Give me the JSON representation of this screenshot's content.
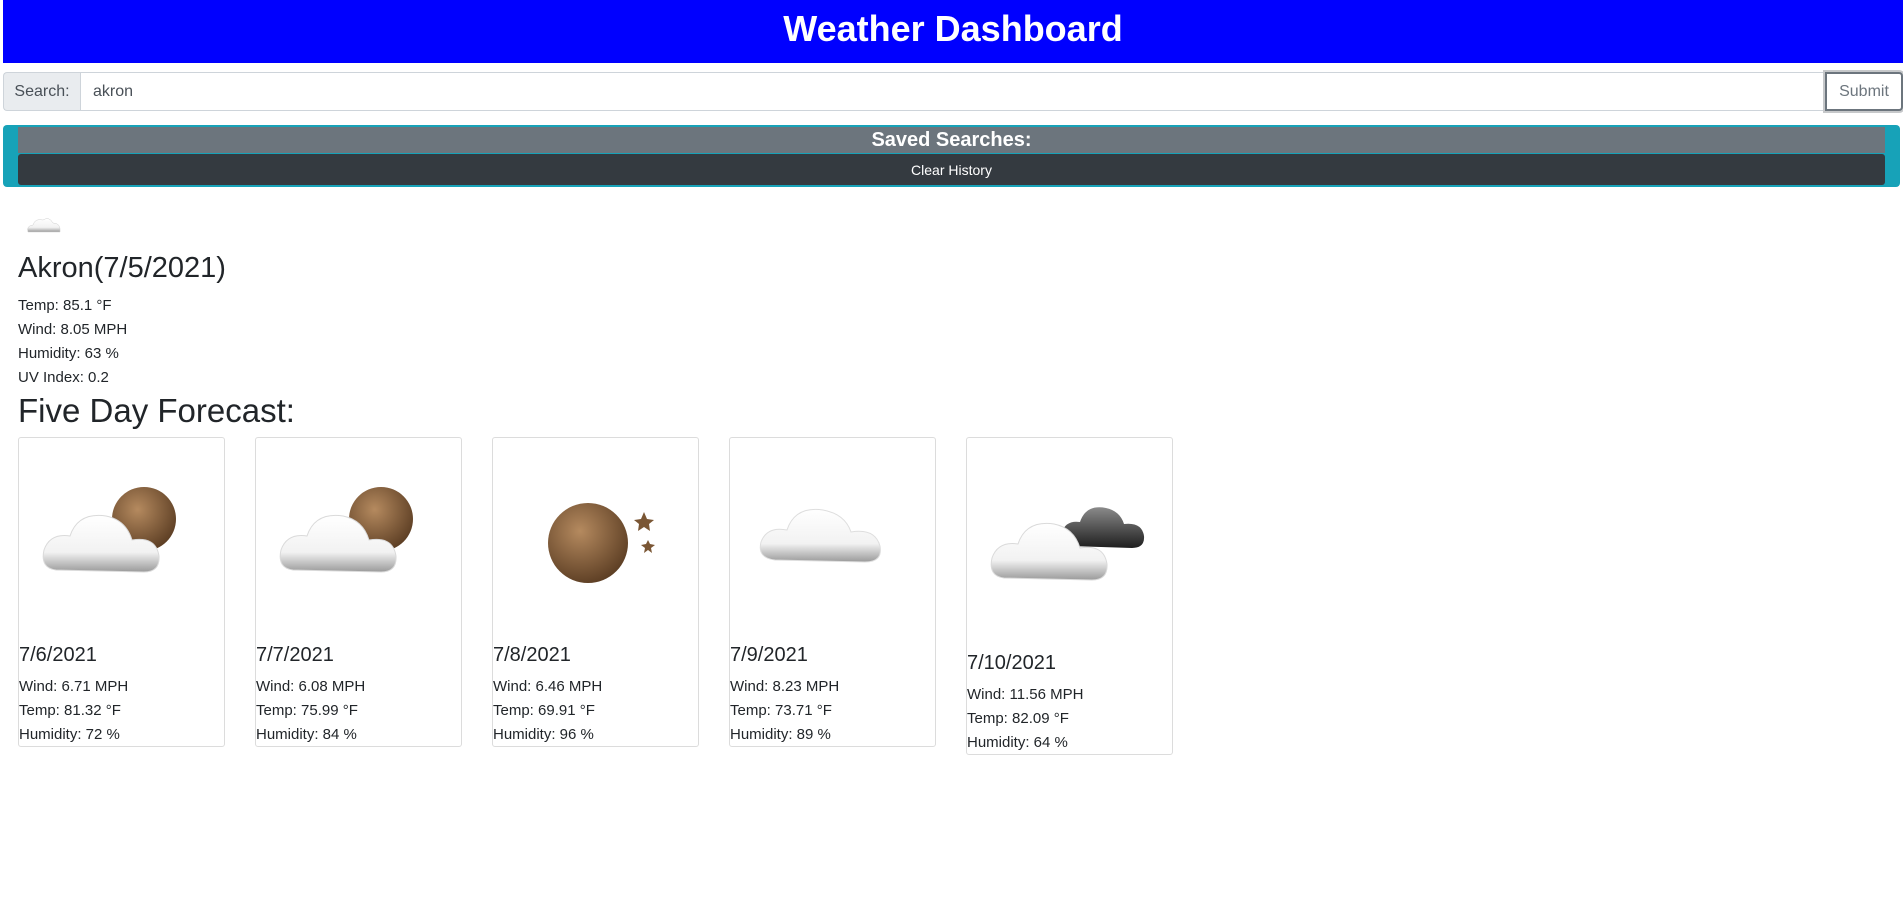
{
  "header": {
    "title": "Weather Dashboard"
  },
  "search": {
    "label": "Search:",
    "value": "akron",
    "submit_label": "Submit"
  },
  "saved_searches": {
    "title": "Saved Searches:",
    "clear_label": "Clear History"
  },
  "current": {
    "icon": "cloud-icon",
    "title": "Akron(7/5/2021)",
    "temp": "Temp: 85.1 °F",
    "wind": "Wind: 8.05 MPH",
    "humidity": "Humidity: 63 %",
    "uv": "UV Index: 0.2"
  },
  "forecast": {
    "title": "Five Day Forecast:",
    "days": [
      {
        "icon": "partly-cloudy-night-icon",
        "date": "7/6/2021",
        "wind": "Wind: 6.71 MPH",
        "temp": "Temp: 81.32 °F",
        "humidity": "Humidity: 72 %"
      },
      {
        "icon": "partly-cloudy-night-icon",
        "date": "7/7/2021",
        "wind": "Wind: 6.08 MPH",
        "temp": "Temp: 75.99 °F",
        "humidity": "Humidity: 84 %"
      },
      {
        "icon": "clear-night-icon",
        "date": "7/8/2021",
        "wind": "Wind: 6.46 MPH",
        "temp": "Temp: 69.91 °F",
        "humidity": "Humidity: 96 %"
      },
      {
        "icon": "cloud-icon",
        "date": "7/9/2021",
        "wind": "Wind: 8.23 MPH",
        "temp": "Temp: 73.71 °F",
        "humidity": "Humidity: 89 %"
      },
      {
        "icon": "broken-clouds-icon",
        "date": "7/10/2021",
        "wind": "Wind: 11.56 MPH",
        "temp": "Temp: 82.09 °F",
        "humidity": "Humidity: 64 %"
      }
    ]
  },
  "colors": {
    "header_bg": "#0000ff",
    "saved_bg": "#17a2b8",
    "saved_title_bg": "#6c757d",
    "clear_btn_bg": "#343a40"
  }
}
